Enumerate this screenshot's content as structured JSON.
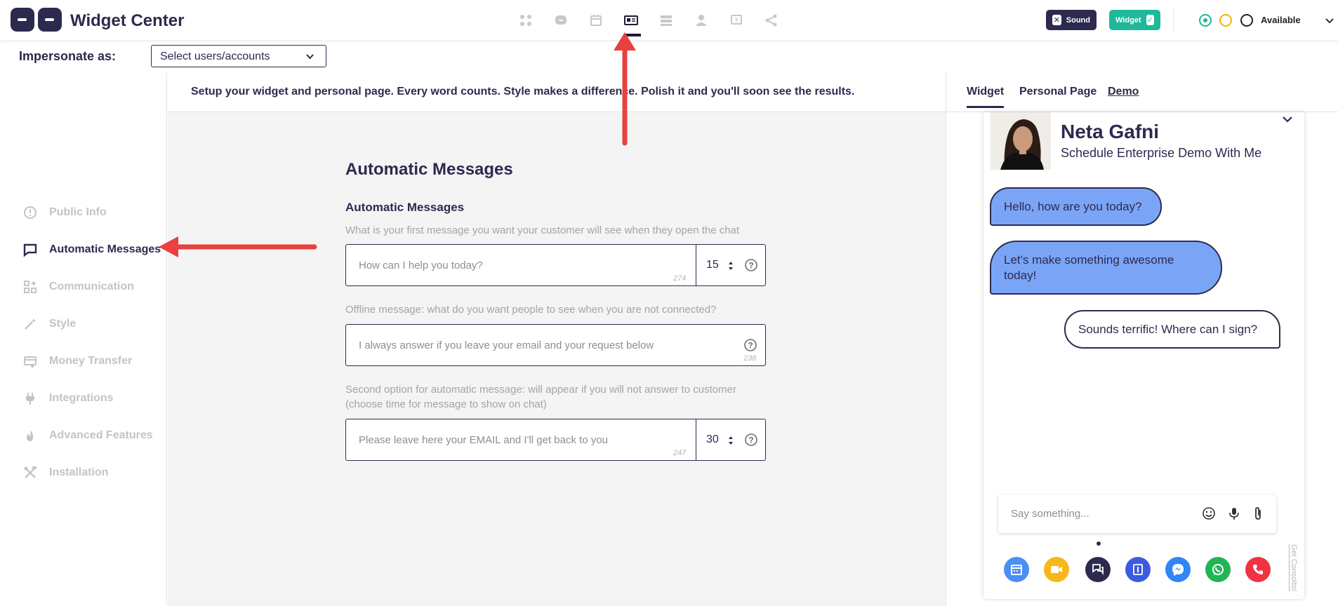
{
  "app": {
    "title": "Widget Center"
  },
  "toolbar": {
    "icons": [
      "dashboard-icon",
      "chat-icon",
      "calendar-icon",
      "id-card-icon",
      "list-icon",
      "user-icon",
      "question-icon",
      "share-icon"
    ],
    "active_index": 3,
    "sound_label": "Sound",
    "widget_label": "Widget",
    "availability": "Available"
  },
  "impersonate": {
    "label": "Impersonate as:",
    "select_value": "Select users/accounts"
  },
  "sidebar": {
    "items": [
      {
        "label": "Public Info",
        "icon": "info-circle-icon",
        "active": false
      },
      {
        "label": "Automatic Messages",
        "icon": "message-icon",
        "active": true
      },
      {
        "label": "Communication",
        "icon": "grid-plus-icon",
        "active": false
      },
      {
        "label": "Style",
        "icon": "magic-wand-icon",
        "active": false
      },
      {
        "label": "Money Transfer",
        "icon": "money-transfer-icon",
        "active": false
      },
      {
        "label": "Integrations",
        "icon": "plug-icon",
        "active": false
      },
      {
        "label": "Advanced Features",
        "icon": "flame-icon",
        "active": false
      },
      {
        "label": "Installation",
        "icon": "tools-icon",
        "active": false
      }
    ]
  },
  "main": {
    "header_text": "Setup your widget and personal page. Every word counts. Style makes a difference. Polish it and you'll soon see the results.",
    "section_title": "Automatic Messages",
    "subsection_title": "Automatic Messages",
    "fields": [
      {
        "description": "What is your first message you want your customer will see when they open the chat",
        "placeholder": "How can I help you today?",
        "count": "274",
        "number": "15"
      },
      {
        "description": "Offline message: what do you want people to see when you are not connected?",
        "placeholder": "I always answer if you leave your email and your request below",
        "count": "238"
      },
      {
        "description": "Second option for automatic message: will appear if you will not answer to customer (choose time for message to show on chat)",
        "placeholder": "Please leave here your EMAIL and I'll get back to you",
        "count": "247",
        "number": "30"
      }
    ]
  },
  "preview": {
    "tabs": [
      "Widget",
      "Personal Page",
      "Demo"
    ],
    "active_tab": 0,
    "agent_name": "Neta Gafni",
    "agent_subtitle": "Schedule Enterprise Demo With Me",
    "messages": [
      {
        "from": "bot",
        "text": "Hello, how are you today?"
      },
      {
        "from": "bot",
        "text": "Let's make something awesome today!"
      },
      {
        "from": "user",
        "text": "Sounds terrific! Where can I sign?"
      }
    ],
    "input_placeholder": "Say something...",
    "footer_link": "Get Consolto!",
    "action_buttons": [
      {
        "icon": "calendar-icon",
        "color": "#4c8df6"
      },
      {
        "icon": "video-icon",
        "color": "#f7b719"
      },
      {
        "icon": "chat-icon",
        "color": "#2d2a4f"
      },
      {
        "icon": "form-icon",
        "color": "#3b5ce0"
      },
      {
        "icon": "messenger-icon",
        "color": "#2f86f7"
      },
      {
        "icon": "whatsapp-icon",
        "color": "#22b455"
      },
      {
        "icon": "phone-icon",
        "color": "#ef3340"
      }
    ]
  },
  "colors": {
    "primary": "#2d2a4f",
    "accent_green": "#1fb89b",
    "bot_bubble": "#7aa5f7",
    "arrow": "#e8413f"
  }
}
